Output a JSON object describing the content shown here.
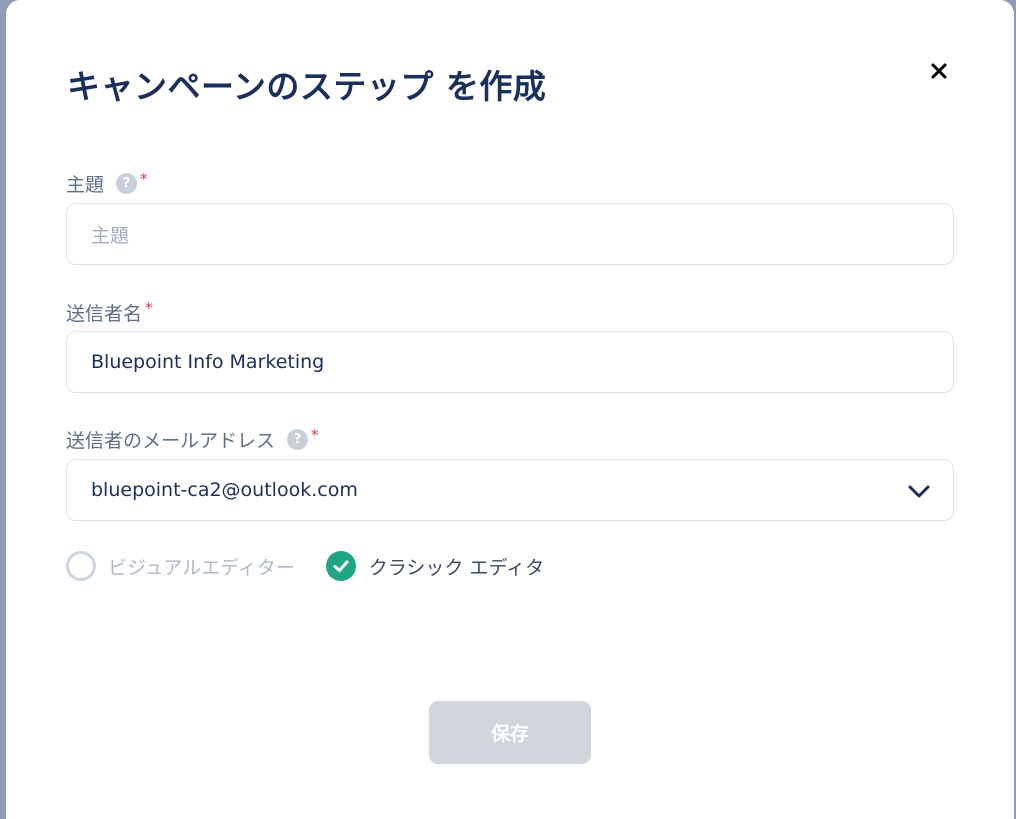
{
  "modal": {
    "title": "キャンペーンのステップ を作成",
    "close_icon": "close-icon"
  },
  "subject": {
    "label": "主題",
    "help_glyph": "?",
    "required_mark": "*",
    "placeholder": "主題",
    "value": ""
  },
  "sender_name": {
    "label": "送信者名",
    "required_mark": "*",
    "value": "Bluepoint Info Marketing"
  },
  "sender_email": {
    "label": "送信者のメールアドレス",
    "help_glyph": "?",
    "required_mark": "*",
    "selected": "bluepoint-ca2@outlook.com",
    "icon": "chevron-down-icon"
  },
  "editor_mode": {
    "options": [
      {
        "label": "ビジュアルエディター",
        "checked": false
      },
      {
        "label": "クラシック エディタ",
        "checked": true
      }
    ]
  },
  "actions": {
    "save_label": "保存"
  },
  "colors": {
    "title": "#1b2f5c",
    "check_accent": "#20a684",
    "required": "#e0324f",
    "save_disabled": "#d0d6dc"
  }
}
